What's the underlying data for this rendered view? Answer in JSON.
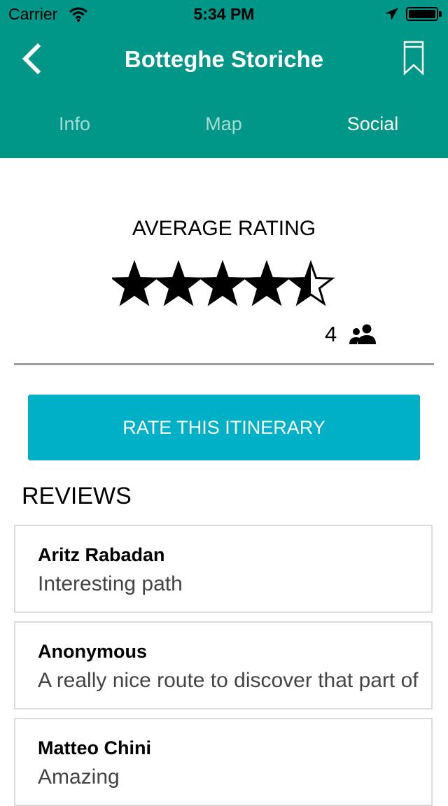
{
  "status_bar": {
    "carrier": "Carrier",
    "time": "5:34 PM"
  },
  "header": {
    "title": "Botteghe Storiche",
    "back_icon": "chevron-left-icon",
    "bookmark_icon": "bookmark-icon",
    "background_color": "#009688"
  },
  "tabs": [
    {
      "label": "Info",
      "active": false
    },
    {
      "label": "Map",
      "active": false
    },
    {
      "label": "Social",
      "active": true
    }
  ],
  "rating": {
    "label": "AVERAGE RATING",
    "value": 4.5,
    "max": 5,
    "count": "4",
    "count_icon": "people-icon"
  },
  "rate_button": {
    "label": "RATE THIS ITINERARY",
    "color": "#00b0c6"
  },
  "reviews": {
    "label": "REVIEWS",
    "items": [
      {
        "author": "Aritz Rabadan",
        "text": "Interesting path"
      },
      {
        "author": "Anonymous",
        "text": "A really nice route to discover that part of"
      },
      {
        "author": "Matteo Chini",
        "text": "Amazing"
      }
    ]
  }
}
